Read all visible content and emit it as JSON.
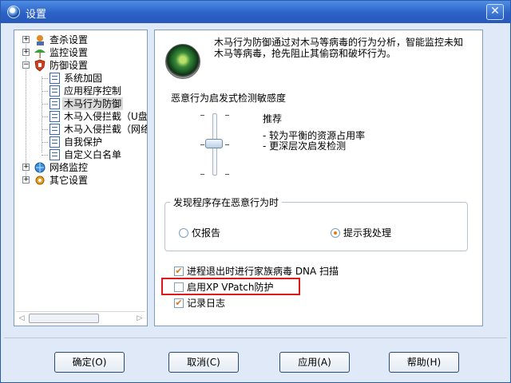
{
  "window": {
    "title": "设置",
    "close_symbol": "✕"
  },
  "tree": {
    "items": [
      {
        "label": "查杀设置",
        "expander": "+",
        "icon": "scan-icon"
      },
      {
        "label": "监控设置",
        "expander": "+",
        "icon": "monitor-umbrella-icon"
      },
      {
        "label": "防御设置",
        "expander": "−",
        "icon": "defense-shield-icon"
      },
      {
        "label": "系统加固",
        "icon": "document-icon"
      },
      {
        "label": "应用程序控制",
        "icon": "document-icon"
      },
      {
        "label": "木马行为防御",
        "icon": "document-icon",
        "selected": true
      },
      {
        "label": "木马入侵拦截（U盘",
        "icon": "document-icon"
      },
      {
        "label": "木马入侵拦截（网络",
        "icon": "document-icon"
      },
      {
        "label": "自我保护",
        "icon": "document-icon"
      },
      {
        "label": "自定义白名单",
        "icon": "document-icon"
      },
      {
        "label": "网络监控",
        "expander": "+",
        "icon": "network-globe-icon"
      },
      {
        "label": "其它设置",
        "expander": "+",
        "icon": "settings-gear-icon"
      }
    ],
    "scroll_left": "◁",
    "scroll_right": "▷"
  },
  "panel": {
    "description": "木马行为防御通过对木马等病毒的行为分析，智能监控未知木马等病毒，抢先阻止其偷窃和破坏行为。",
    "sensitivity_title": "恶意行为启发式检测敏感度",
    "sensitivity_level": "推荐",
    "sensitivity_desc": "- 较为平衡的资源占用率\n- 更深层次启发检测",
    "sensitivity_position": 0.5,
    "group_title": "发现程序存在恶意行为时",
    "radio_report_only": "仅报告",
    "radio_prompt": "提示我处理",
    "radio_selected": "提示我处理",
    "check_dna": {
      "label": "进程退出时进行家族病毒 DNA 扫描",
      "checked": true
    },
    "check_xp_vpatch": {
      "label": "启用XP VPatch防护",
      "checked": false
    },
    "check_log": {
      "label": "记录日志",
      "checked": true
    }
  },
  "buttons": {
    "ok": "确定(O)",
    "cancel": "取消(C)",
    "apply": "应用(A)",
    "help": "帮助(H)"
  },
  "colors": {
    "titlebar": "#2c62c6",
    "accent_check": "#e07a1b",
    "highlight_border": "#e01818"
  }
}
